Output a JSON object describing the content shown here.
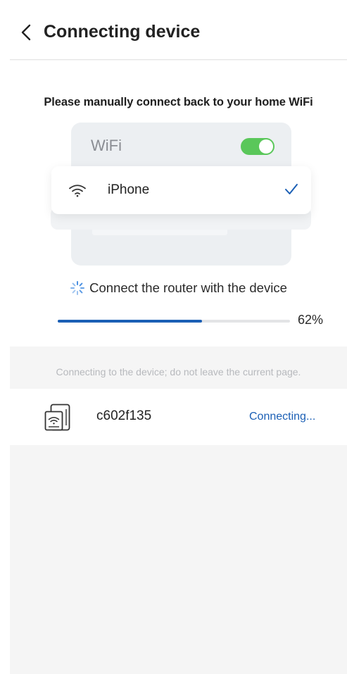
{
  "header": {
    "title": "Connecting device",
    "back_icon": "chevron-left-icon"
  },
  "instruction": "Please manually connect back to your home WiFi",
  "illustration": {
    "wifi_label": "WiFi",
    "toggle_on": true,
    "toggle_color": "#5ac75a",
    "network_name": "iPhone",
    "network_icon": "wifi-icon",
    "selected_icon": "check-icon"
  },
  "status": {
    "icon": "spinner-icon",
    "text": "Connect the router with the device"
  },
  "progress": {
    "value": 62,
    "label": "62%",
    "color": "#1b5fb5"
  },
  "notice": "Connecting to the device; do not leave the current page.",
  "device": {
    "icon": "router-device-icon",
    "name": "c602f135",
    "status": "Connecting...",
    "status_color": "#1b5fb5"
  }
}
